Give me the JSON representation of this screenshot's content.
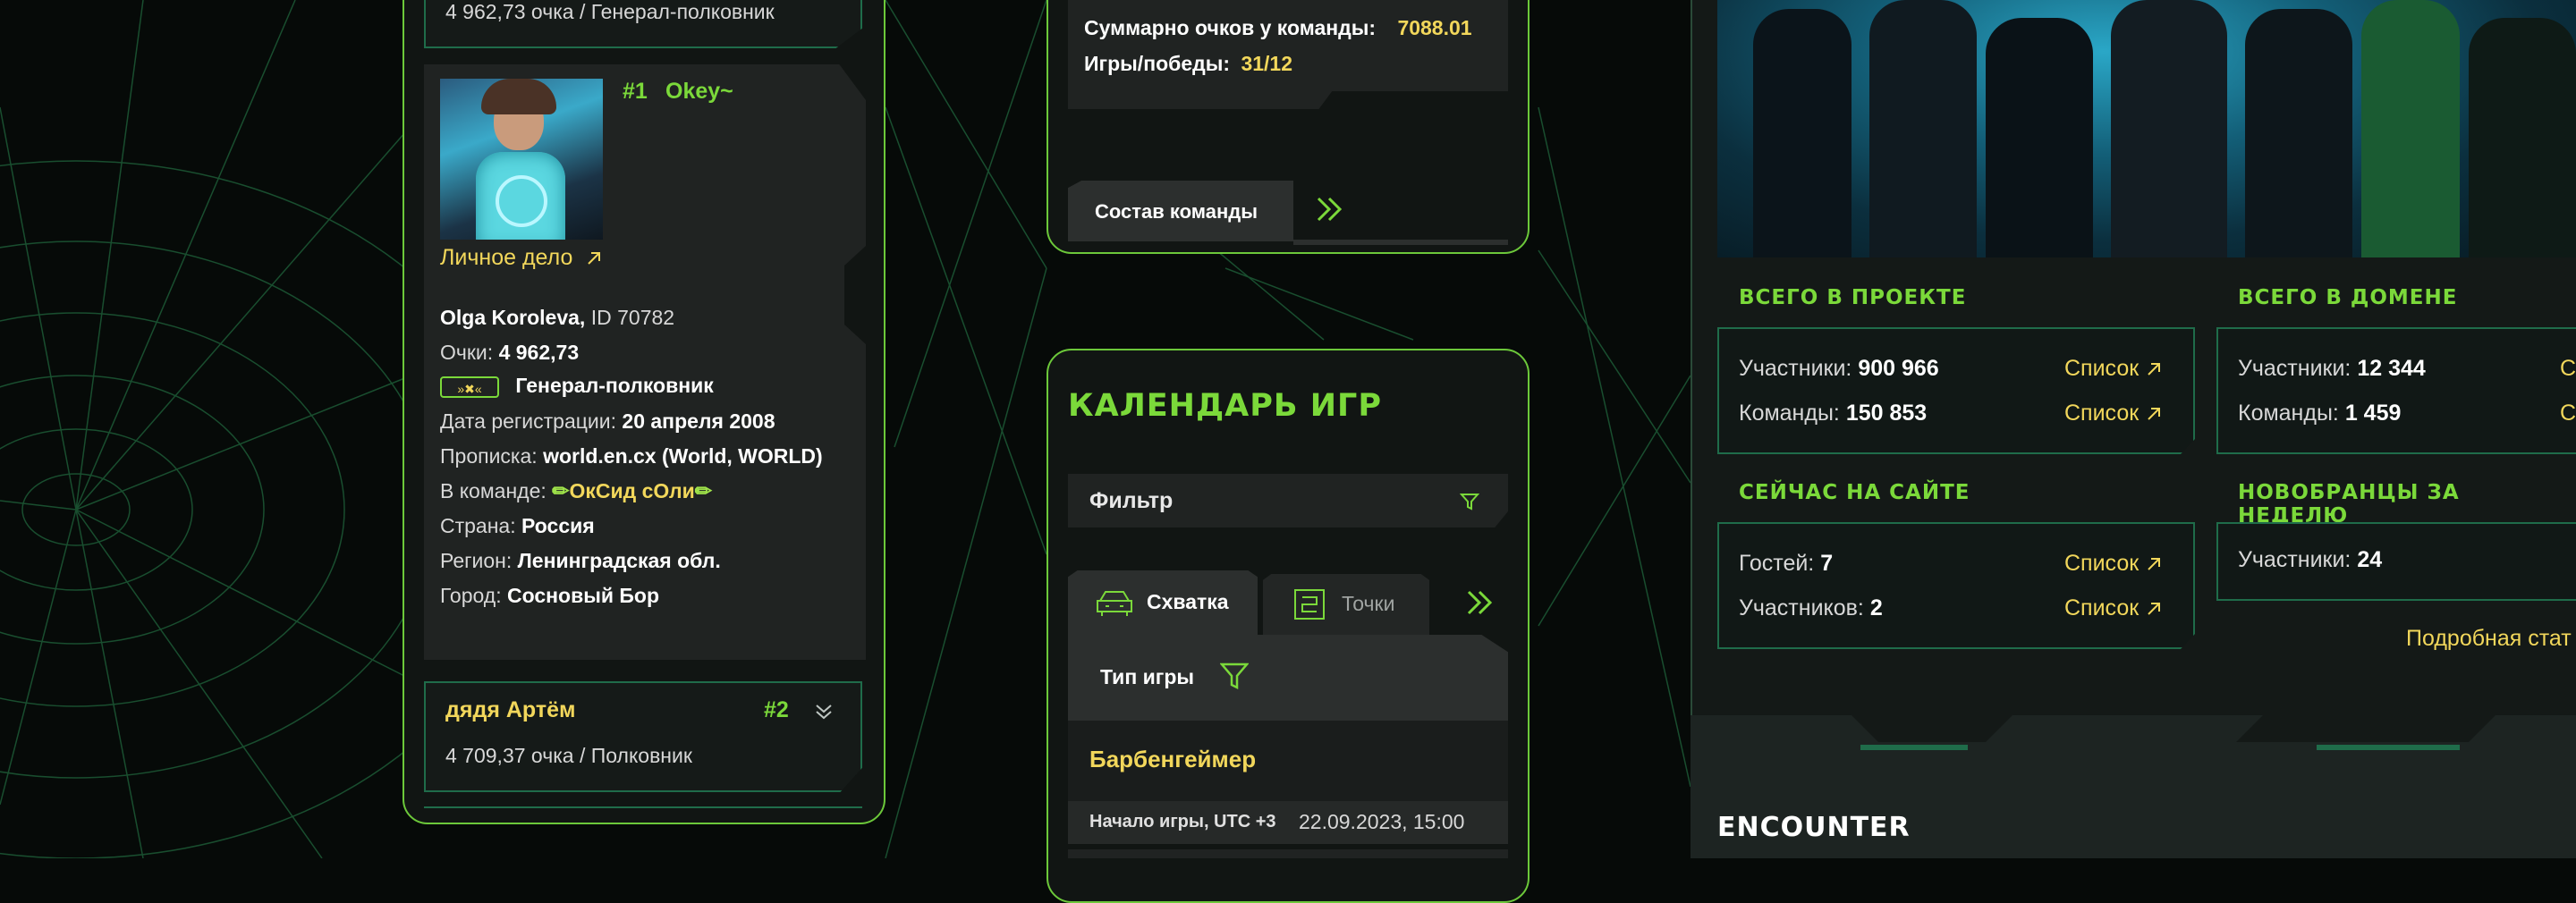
{
  "leaderboard": {
    "top_row_score": "4 962,73 очка / Генерал-полковник",
    "player1": {
      "rank": "#1",
      "nick": "Okey~",
      "file_link": "Личное дело",
      "name": "Olga Koroleva,",
      "id_text": "ID 70782",
      "points_label": "Очки:",
      "points_value": "4 962,73",
      "title": "Генерал-полковник",
      "reg_label": "Дата регистрации:",
      "reg_value": "20 апреля 2008",
      "home_label": "Прописка:",
      "home_value": "world.en.cx (World, WORLD)",
      "team_label": "В команде:",
      "team_value": "ОкСид сОли",
      "country_label": "Страна:",
      "country_value": "Россия",
      "region_label": "Регион:",
      "region_value": "Ленинградская обл.",
      "city_label": "Город:",
      "city_value": "Сосновый Бор"
    },
    "player2": {
      "nick": "дядя Артём",
      "rank": "#2",
      "score": "4 709,37 очка / Полковник"
    }
  },
  "team": {
    "total_label": "Суммарно очков у команды:",
    "total_value": "7088.01",
    "games_label": "Игры/победы:",
    "games_value": "31/12",
    "roster_tab": "Состав команды"
  },
  "calendar": {
    "title": "Календарь игр",
    "filter_label": "Фильтр",
    "tabs": [
      {
        "label": "Схватка",
        "active": true
      },
      {
        "label": "Точки",
        "active": false
      }
    ],
    "game_type_label": "Тип игры",
    "game_name": "Барбенгеймер",
    "start_label": "Начало игры, UTC +3",
    "start_value": "22.09.2023, 15:00"
  },
  "stats": {
    "project": {
      "title": "Всего в проекте",
      "rows": [
        {
          "label": "Участники:",
          "value": "900 966",
          "link": "Список"
        },
        {
          "label": "Команды:",
          "value": "150 853",
          "link": "Список"
        }
      ]
    },
    "domain": {
      "title": "Всего в домене",
      "rows": [
        {
          "label": "Участники:",
          "value": "12 344",
          "link": "С"
        },
        {
          "label": "Команды:",
          "value": "1 459",
          "link": "С"
        }
      ]
    },
    "online": {
      "title": "Сейчас на сайте",
      "rows": [
        {
          "label": "Гостей:",
          "value": "7",
          "link": "Список"
        },
        {
          "label": "Участников:",
          "value": "2",
          "link": "Список"
        }
      ]
    },
    "newbies": {
      "title": "Новобранцы за неделю",
      "rows": [
        {
          "label": "Участники:",
          "value": "24"
        }
      ]
    },
    "details_link": "Подробная стат"
  },
  "footer": {
    "logo": "ENCOUNTER"
  },
  "colors": {
    "accent_green": "#7bd93a",
    "accent_yellow": "#f2d75b",
    "panel_border": "#6cc83a",
    "background": "#060a08"
  }
}
